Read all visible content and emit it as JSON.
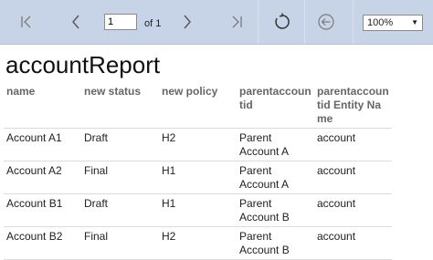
{
  "toolbar": {
    "page_number": "1",
    "page_of": "of 1",
    "zoom": "100%",
    "icons": {
      "first": "first-page-icon",
      "prev": "previous-page-icon",
      "next": "next-page-icon",
      "last": "last-page-icon",
      "refresh": "refresh-icon",
      "back": "back-icon",
      "dropdown": "chevron-down-icon"
    },
    "colors": {
      "background": "#c7d4e8",
      "icon": "#6b6b6b"
    }
  },
  "report": {
    "title": "accountReport",
    "columns": [
      "name",
      "new status",
      "new policy",
      "parentaccountid",
      "parentaccountid Entity Name"
    ],
    "rows": [
      [
        "Account A1",
        "Draft",
        "H2",
        "Parent Account A",
        "account"
      ],
      [
        "Account A2",
        "Final",
        "H1",
        "Parent Account A",
        "account"
      ],
      [
        "Account B1",
        "Draft",
        "H1",
        "Parent Account B",
        "account"
      ],
      [
        "Account B2",
        "Final",
        "H2",
        "Parent Account B",
        "account"
      ]
    ]
  }
}
